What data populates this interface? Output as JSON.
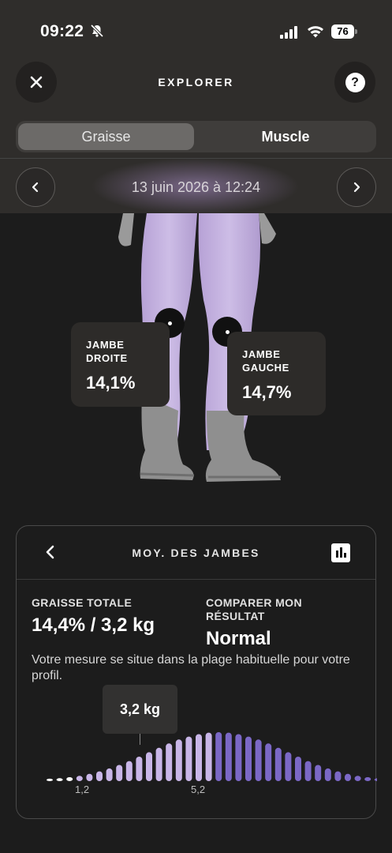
{
  "status": {
    "time": "09:22",
    "battery": "76"
  },
  "header": {
    "title": "EXPLORER",
    "help_glyph": "?"
  },
  "segments": {
    "left": "Graisse",
    "right": "Muscle",
    "selected": "Graisse"
  },
  "date_nav": {
    "date": "13 juin 2026 à 12:24"
  },
  "legs": {
    "right": {
      "label": "JAMBE DROITE",
      "value": "14,1%"
    },
    "left": {
      "label": "JAMBE GAUCHE",
      "value": "14,7%"
    }
  },
  "card": {
    "title": "MOY. DES JAMBES",
    "total_label": "GRAISSE TOTALE",
    "total_value": "14,4% / 3,2 kg",
    "compare_label": "COMPARER MON RÉSULTAT",
    "compare_value": "Normal",
    "description": "Votre mesure se situe dans la plage habituelle pour votre profil.",
    "tooltip": "3,2 kg",
    "axis_labels": [
      "1,2",
      "5,2"
    ]
  },
  "colors": {
    "accent_light": "#c9b6e8",
    "accent_dark": "#7b68c6",
    "body_fill": "#c4b2de"
  },
  "chart_data": {
    "type": "bar",
    "title": "",
    "xlabel": "",
    "ylabel": "",
    "values": [
      0.05,
      0.06,
      0.08,
      0.11,
      0.15,
      0.2,
      0.26,
      0.33,
      0.41,
      0.5,
      0.59,
      0.68,
      0.77,
      0.85,
      0.91,
      0.96,
      0.99,
      1.0,
      0.99,
      0.96,
      0.91,
      0.85,
      0.77,
      0.68,
      0.59,
      0.5,
      0.41,
      0.33,
      0.26,
      0.2,
      0.15,
      0.11,
      0.08,
      0.06,
      0.05,
      0.04
    ],
    "highlight_until_index": 16,
    "marker_index": 11,
    "x_ticks": [
      {
        "label": "1,2",
        "index": 4
      },
      {
        "label": "5,2",
        "index": 18
      }
    ]
  }
}
